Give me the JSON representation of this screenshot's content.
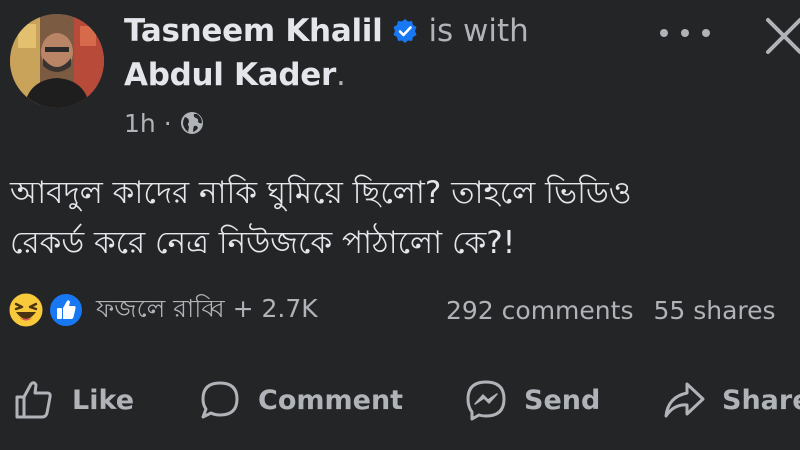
{
  "post": {
    "author": "Tasneem Khalil",
    "with_text": "is with",
    "tagged_person": "Abdul Kader",
    "tagged_suffix": ".",
    "time": "1h",
    "separator": "·",
    "privacy_icon": "globe-icon",
    "body_line1": "আবদুল কাদের নাকি ঘুমিয়ে ছিলো? তাহলে ভিডিও",
    "body_line2": "রেকর্ড করে নেত্র নিউজকে পাঠালো কে?!"
  },
  "reactions": {
    "icons": [
      "haha-reaction-icon",
      "like-reaction-icon"
    ],
    "summary": "ফজলে রাব্বি + 2.7K"
  },
  "stats": {
    "comments": "292 comments",
    "shares": "55 shares"
  },
  "actions": {
    "like": "Like",
    "comment": "Comment",
    "send": "Send",
    "share": "Share"
  },
  "colors": {
    "background": "#242526",
    "primary_text": "#e4e6eb",
    "secondary_text": "#b0b3b8",
    "verified_blue": "#1877f2",
    "like_blue": "#1877f2",
    "haha_yellow": "#f7c93b"
  }
}
